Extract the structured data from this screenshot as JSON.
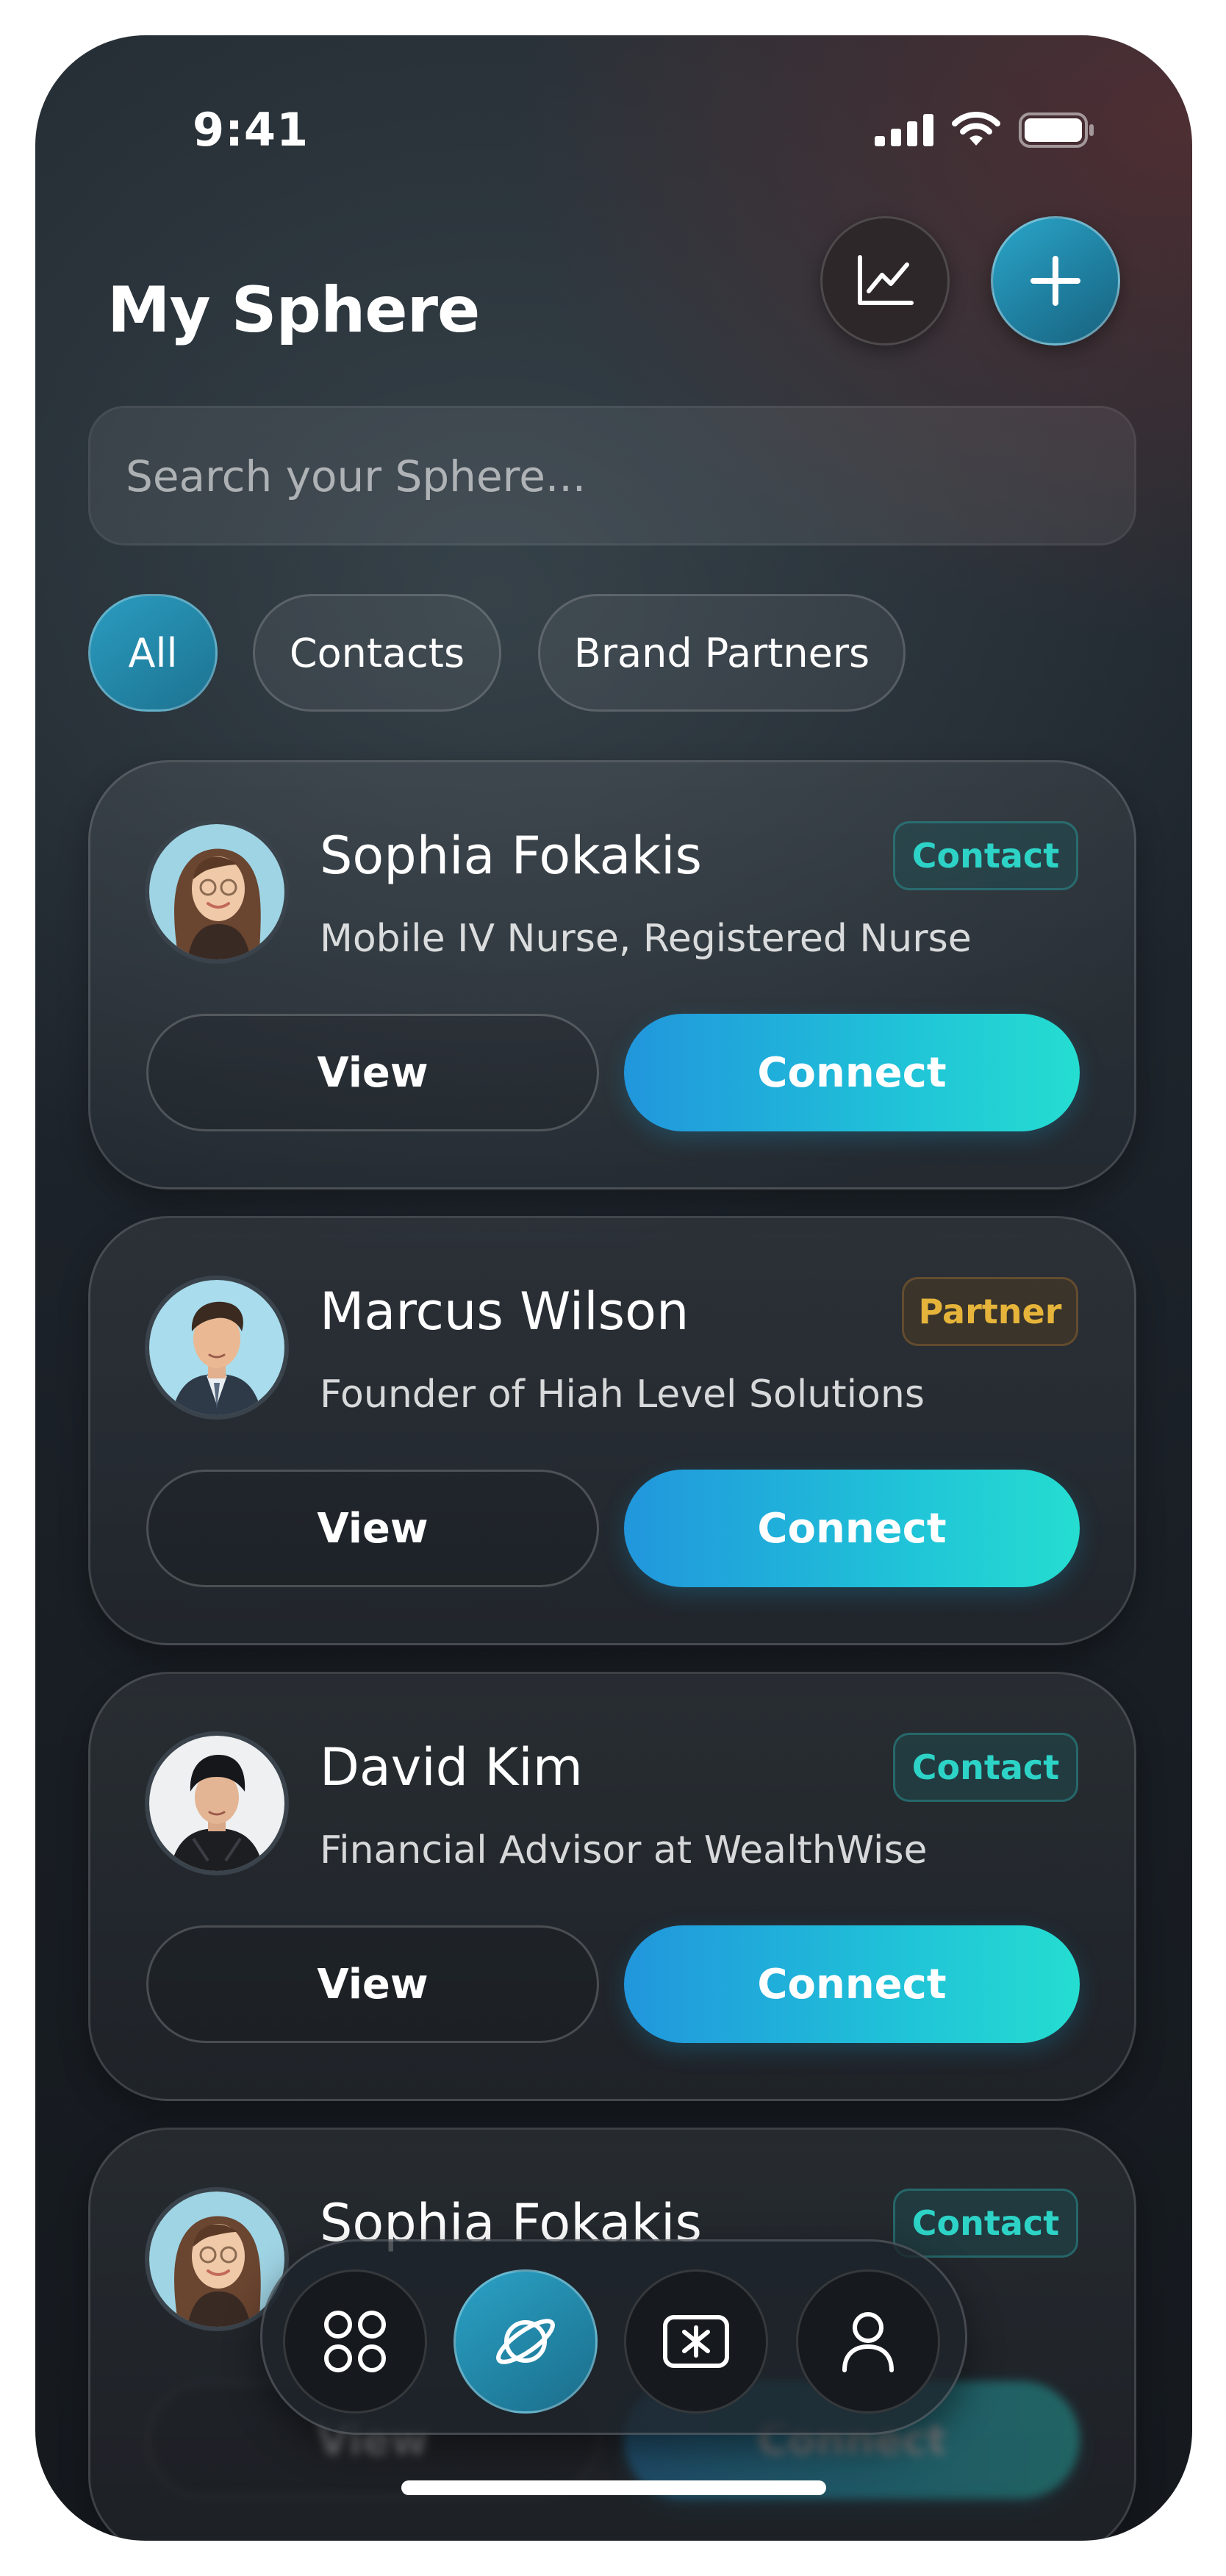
{
  "status_bar": {
    "time": "9:41"
  },
  "header": {
    "title": "My Sphere",
    "analytics_icon": "line-chart-icon",
    "add_icon": "plus-icon"
  },
  "search": {
    "placeholder": "Search your Sphere..."
  },
  "filters": {
    "active": "All",
    "items": [
      {
        "label": "All"
      },
      {
        "label": "Contacts"
      },
      {
        "label": "Brand Partners"
      }
    ]
  },
  "cards": [
    {
      "name": "Sophia Fokakis",
      "role": "Mobile IV Nurse, Registered Nurse",
      "badge": "Contact",
      "view_label": "View",
      "connect_label": "Connect"
    },
    {
      "name": "Marcus Wilson",
      "role": "Founder of Hiah Level Solutions",
      "badge": "Partner",
      "view_label": "View",
      "connect_label": "Connect"
    },
    {
      "name": "David Kim",
      "role": "Financial Advisor at WealthWise",
      "badge": "Contact",
      "view_label": "View",
      "connect_label": "Connect"
    },
    {
      "name": "Sophia Fokakis",
      "role": "",
      "badge": "Contact",
      "view_label": "View",
      "connect_label": "Connect"
    }
  ],
  "bottom_nav": {
    "items": [
      {
        "icon": "grid-icon"
      },
      {
        "icon": "planet-icon"
      },
      {
        "icon": "sparkle-card-icon"
      },
      {
        "icon": "user-icon"
      }
    ],
    "active_index": 1
  },
  "colors": {
    "accent": "#20c2d8",
    "contact_badge": "#2dd3c6",
    "partner_badge": "#e6b43a"
  }
}
